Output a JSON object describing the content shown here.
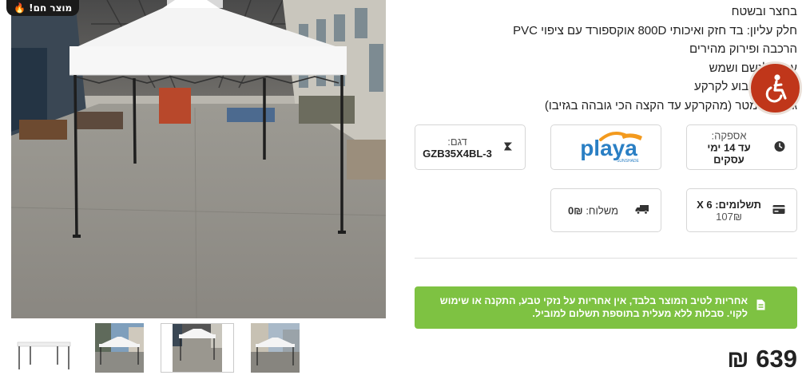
{
  "gallery": {
    "badge": "מוצר חם! 🔥",
    "main_image_alt": "white pop-up canopy tent in a warehouse",
    "thumbnails": [
      "tent-white-background",
      "tent-outdoor-buildings",
      "tent-warehouse",
      "tent-parking-lot"
    ],
    "active_thumbnail": 3
  },
  "description": {
    "lines": [
      "בחצר ובשטח",
      "חלק עליון: בד חזק ואיכותי 800D אוקספורד עם ציפוי PVC",
      "הרכבה ופירוק מהירים",
      "עמיד לגשם ושמש",
      "יתדות לקיבוע לקרקע",
      "גובה: 3 מטר (מהקרקע עד הקצה הכי גובהה בגזיבו)"
    ]
  },
  "info_boxes": {
    "delivery": {
      "label": "אספקה:",
      "value": "עד 14 ימי עסקים",
      "icon": "clock-icon"
    },
    "brand": {
      "name": "playa",
      "tagline": "SUNSHADE"
    },
    "model": {
      "label": "דגם:",
      "value": "GZB35X4BL-3",
      "icon": "sku-icon"
    },
    "installments": {
      "label": "תשלומים: 6 X",
      "value": "107₪",
      "icon": "credit-card-icon"
    },
    "shipping": {
      "label": "משלוח:",
      "value": "0₪",
      "icon": "truck-icon"
    }
  },
  "warranty": {
    "text": "אחריות לטיב המוצר בלבד, אין אחריות על נזקי טבע, התקנה או שימוש לקוי. סבלות ללא מעלית בתוספת תשלום למוביל.",
    "icon": "document-icon"
  },
  "price": {
    "amount": "639",
    "currency": "₪"
  },
  "accessibility": {
    "icon": "wheelchair-icon"
  },
  "colors": {
    "warranty_bg": "#7ec242",
    "accessibility_bg": "#c0361a",
    "brand_blue": "#2a7fc4",
    "brand_orange": "#f39a1e"
  }
}
